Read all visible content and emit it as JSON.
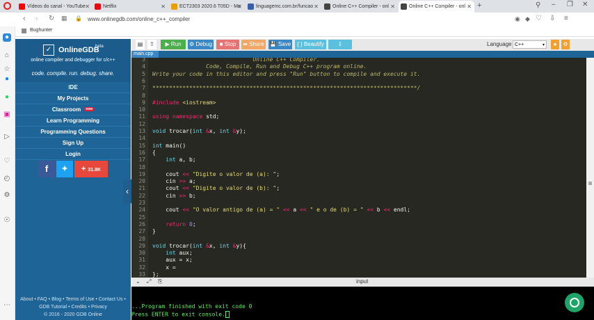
{
  "browser": {
    "tabs": [
      {
        "label": "Vídeos do canal - YouTube",
        "color": "#ff0000",
        "active": false
      },
      {
        "label": "Netflix",
        "color": "#e50914",
        "active": false
      },
      {
        "label": "ECT2303 2020.6 T05D - Mo",
        "color": "#e8a000",
        "active": false
      },
      {
        "label": "linguagemc.com.br/funcao",
        "color": "#3a5fa8",
        "active": false
      },
      {
        "label": "Online C++ Compiler - onl",
        "color": "#444444",
        "active": false
      },
      {
        "label": "Online C++ Compiler - onl",
        "color": "#444444",
        "active": true
      }
    ],
    "new_tab": "+",
    "url": "www.onlinegdb.com/online_c++_compiler",
    "bookmark": "Bughunter"
  },
  "sidebar": {
    "brand": "OnlineGDB",
    "brand_sup": "beta",
    "tagline": "online compiler and debugger for c/c++",
    "slogan": "code. compile. run. debug. share.",
    "nav": [
      "IDE",
      "My Projects",
      "Classroom",
      "Learn Programming",
      "Programming Questions",
      "Sign Up",
      "Login"
    ],
    "classroom_badge": "new",
    "share_count": "31.8K",
    "footer": {
      "line1": "About • FAQ • Blog • Terms of Use • Contact Us •",
      "line2": "GDB Tutorial • Credits • Privacy",
      "line3": "© 2016 - 2020 GDB Online"
    }
  },
  "toolbar": {
    "run": "Run",
    "debug": "Debug",
    "stop": "Stop",
    "share": "Share",
    "save": "Save",
    "beautify": "{ } Beautify",
    "language_label": "Language",
    "language_value": "C++"
  },
  "file_tab": "main.cpp",
  "io_header": "input",
  "console": {
    "line1": "...Program finished with exit code 0",
    "line2": "Press ENTER to exit console."
  },
  "editor": {
    "line_numbers": [
      "3",
      "4",
      "5",
      "6",
      "7",
      "8",
      "9",
      "10",
      "11",
      "12",
      "13",
      "14",
      "15",
      "16",
      "17",
      "18",
      "19",
      "20",
      "21",
      "22",
      "23",
      "24",
      "25",
      "26",
      "27",
      "28",
      "29",
      "30",
      "31",
      "32",
      "33"
    ],
    "lines": [
      "                              Online C++ Compiler.",
      "                Code, Compile, Run and Debug C++ program online.",
      "Write your code in this editor and press \"Run\" button to compile and execute it.",
      "",
      "*******************************************************************************/",
      "",
      "#include <iostream>",
      "",
      "using namespace std;",
      "",
      "void trocar(int &x, int &y);",
      "",
      "int main()",
      "{",
      "    int a, b;",
      "",
      "    cout << \"Digite o valor de (a): \";",
      "    cin >> a;",
      "    cout << \"Digite o valor de (b): \";",
      "    cin >> b;",
      "",
      "    cout << \"O valor antigo de (a) = \" << a << \" e o de (b) = \" << b << endl;",
      "",
      "    return 0;",
      "}",
      "",
      "void trocar(int &x, int &y){",
      "    int aux;",
      "    aux = x;",
      "    x = ",
      "};"
    ]
  }
}
